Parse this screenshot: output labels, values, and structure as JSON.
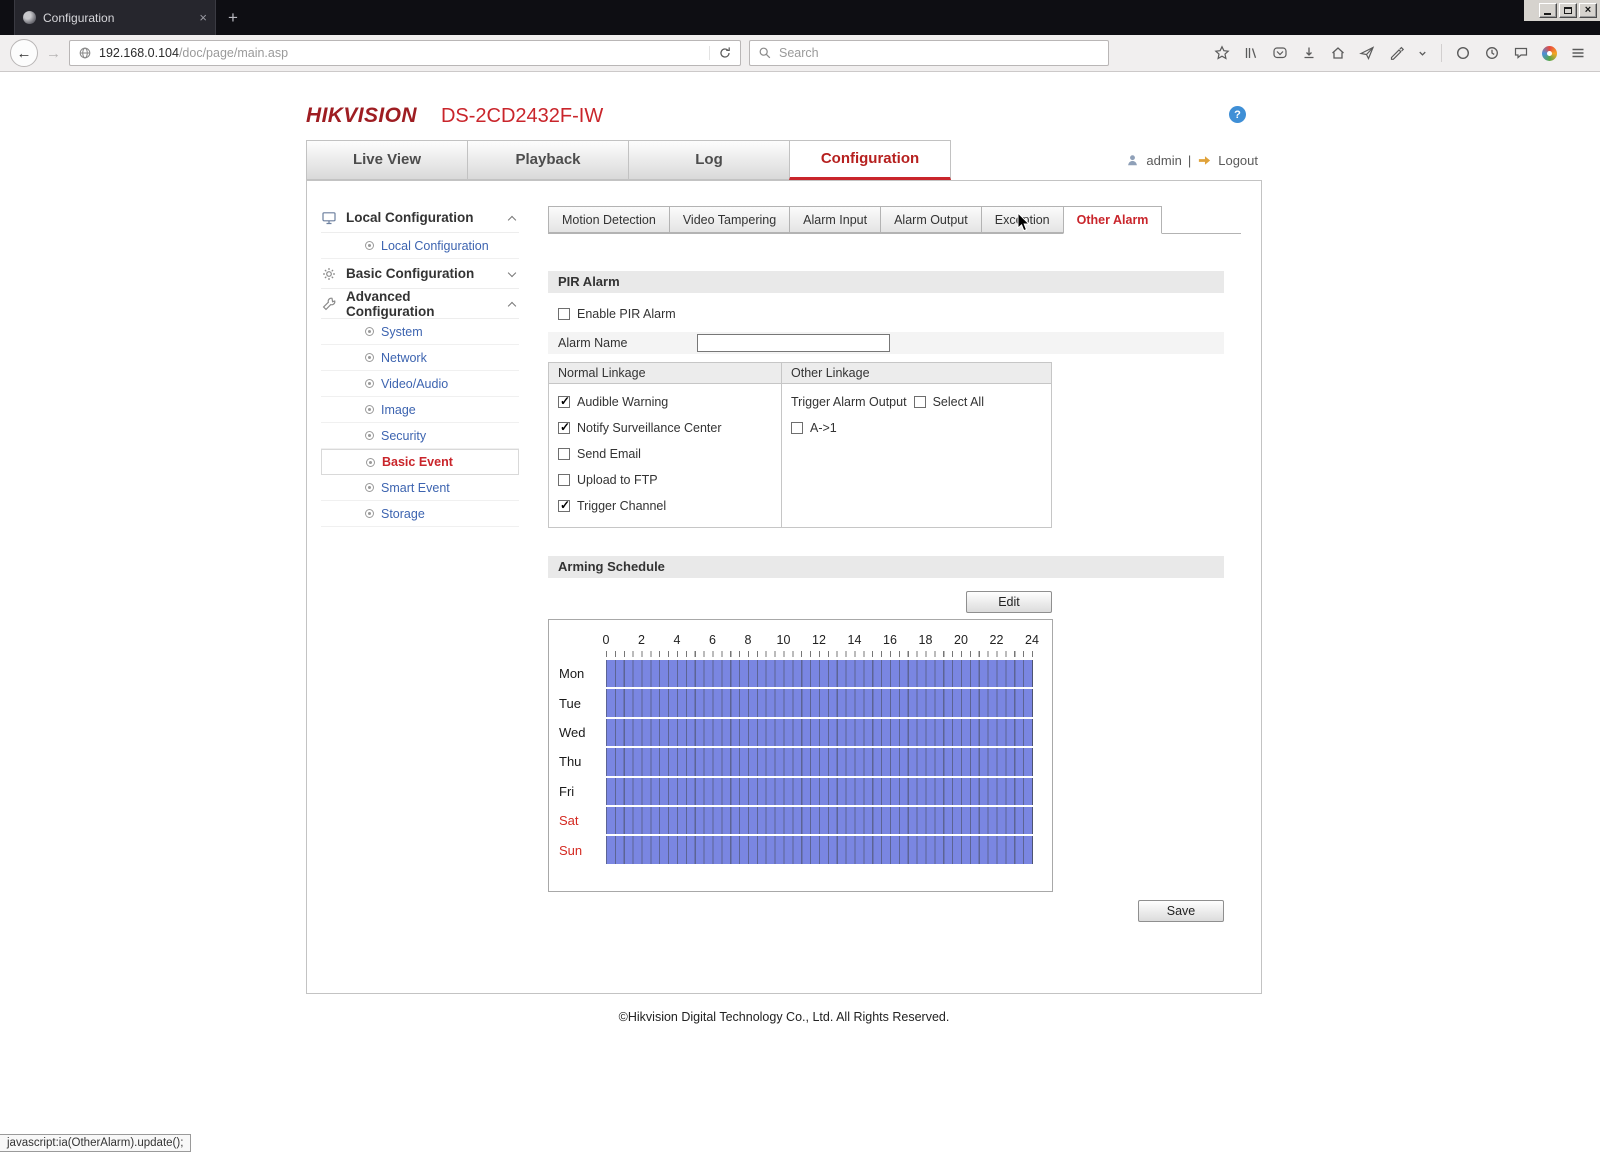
{
  "icons": {
    "back": "←",
    "forward": "→",
    "new_tab": "+",
    "close_tab": "×",
    "close_window": "×",
    "help": "?"
  },
  "browser": {
    "tab": {
      "title": "Configuration"
    },
    "address": {
      "host": "192.168.0.104",
      "path": "/doc/page/main.asp"
    },
    "search": {
      "placeholder": "Search"
    }
  },
  "app": {
    "brand": "HIKVISION",
    "model": "DS-2CD2432F-IW",
    "nav_tabs": [
      {
        "label": "Live View",
        "active": false
      },
      {
        "label": "Playback",
        "active": false
      },
      {
        "label": "Log",
        "active": false
      },
      {
        "label": "Configuration",
        "active": true
      }
    ],
    "user": {
      "name": "admin",
      "separator": "|",
      "logout": "Logout"
    },
    "sidebar": {
      "groups": [
        {
          "label": "Local Configuration",
          "expanded": true,
          "items": [
            {
              "label": "Local Configuration",
              "selected": false
            }
          ]
        },
        {
          "label": "Basic Configuration",
          "expanded": false,
          "items": []
        },
        {
          "label": "Advanced Configuration",
          "expanded": true,
          "items": [
            {
              "label": "System",
              "selected": false
            },
            {
              "label": "Network",
              "selected": false
            },
            {
              "label": "Video/Audio",
              "selected": false
            },
            {
              "label": "Image",
              "selected": false
            },
            {
              "label": "Security",
              "selected": false
            },
            {
              "label": "Basic Event",
              "selected": true
            },
            {
              "label": "Smart Event",
              "selected": false
            },
            {
              "label": "Storage",
              "selected": false
            }
          ]
        }
      ]
    },
    "content": {
      "tabs": [
        {
          "label": "Motion Detection",
          "active": false
        },
        {
          "label": "Video Tampering",
          "active": false
        },
        {
          "label": "Alarm Input",
          "active": false
        },
        {
          "label": "Alarm Output",
          "active": false
        },
        {
          "label": "Exception",
          "active": false
        },
        {
          "label": "Other Alarm",
          "active": true
        }
      ],
      "pir": {
        "title": "PIR Alarm",
        "enable": {
          "label": "Enable PIR Alarm",
          "checked": false
        },
        "alarm_name": {
          "label": "Alarm Name",
          "value": ""
        },
        "linkage": {
          "normal_header": "Normal Linkage",
          "other_header": "Other Linkage",
          "normal_items": [
            {
              "label": "Audible Warning",
              "checked": true
            },
            {
              "label": "Notify Surveillance Center",
              "checked": true
            },
            {
              "label": "Send Email",
              "checked": false
            },
            {
              "label": "Upload to FTP",
              "checked": false
            },
            {
              "label": "Trigger Channel",
              "checked": true
            }
          ],
          "trigger_output_label": "Trigger Alarm Output",
          "select_all": {
            "label": "Select All",
            "checked": false
          },
          "outputs": [
            {
              "label": "A->1",
              "checked": false
            }
          ]
        }
      },
      "schedule": {
        "title": "Arming Schedule",
        "edit_button": "Edit",
        "hours": [
          "0",
          "2",
          "4",
          "6",
          "8",
          "10",
          "12",
          "14",
          "16",
          "18",
          "20",
          "22",
          "24"
        ],
        "days": [
          {
            "label": "Mon",
            "weekend": false,
            "armed_all_day": true
          },
          {
            "label": "Tue",
            "weekend": false,
            "armed_all_day": true
          },
          {
            "label": "Wed",
            "weekend": false,
            "armed_all_day": true
          },
          {
            "label": "Thu",
            "weekend": false,
            "armed_all_day": true
          },
          {
            "label": "Fri",
            "weekend": false,
            "armed_all_day": true
          },
          {
            "label": "Sat",
            "weekend": true,
            "armed_all_day": true
          },
          {
            "label": "Sun",
            "weekend": true,
            "armed_all_day": true
          }
        ]
      },
      "save_button": "Save"
    },
    "footer": "©Hikvision Digital Technology Co., Ltd. All Rights Reserved."
  },
  "statusbar": {
    "text": "javascript:ia(OtherAlarm).update();"
  },
  "colors": {
    "brand_red": "#c9252b",
    "schedule_blue": "#7a86e2"
  }
}
